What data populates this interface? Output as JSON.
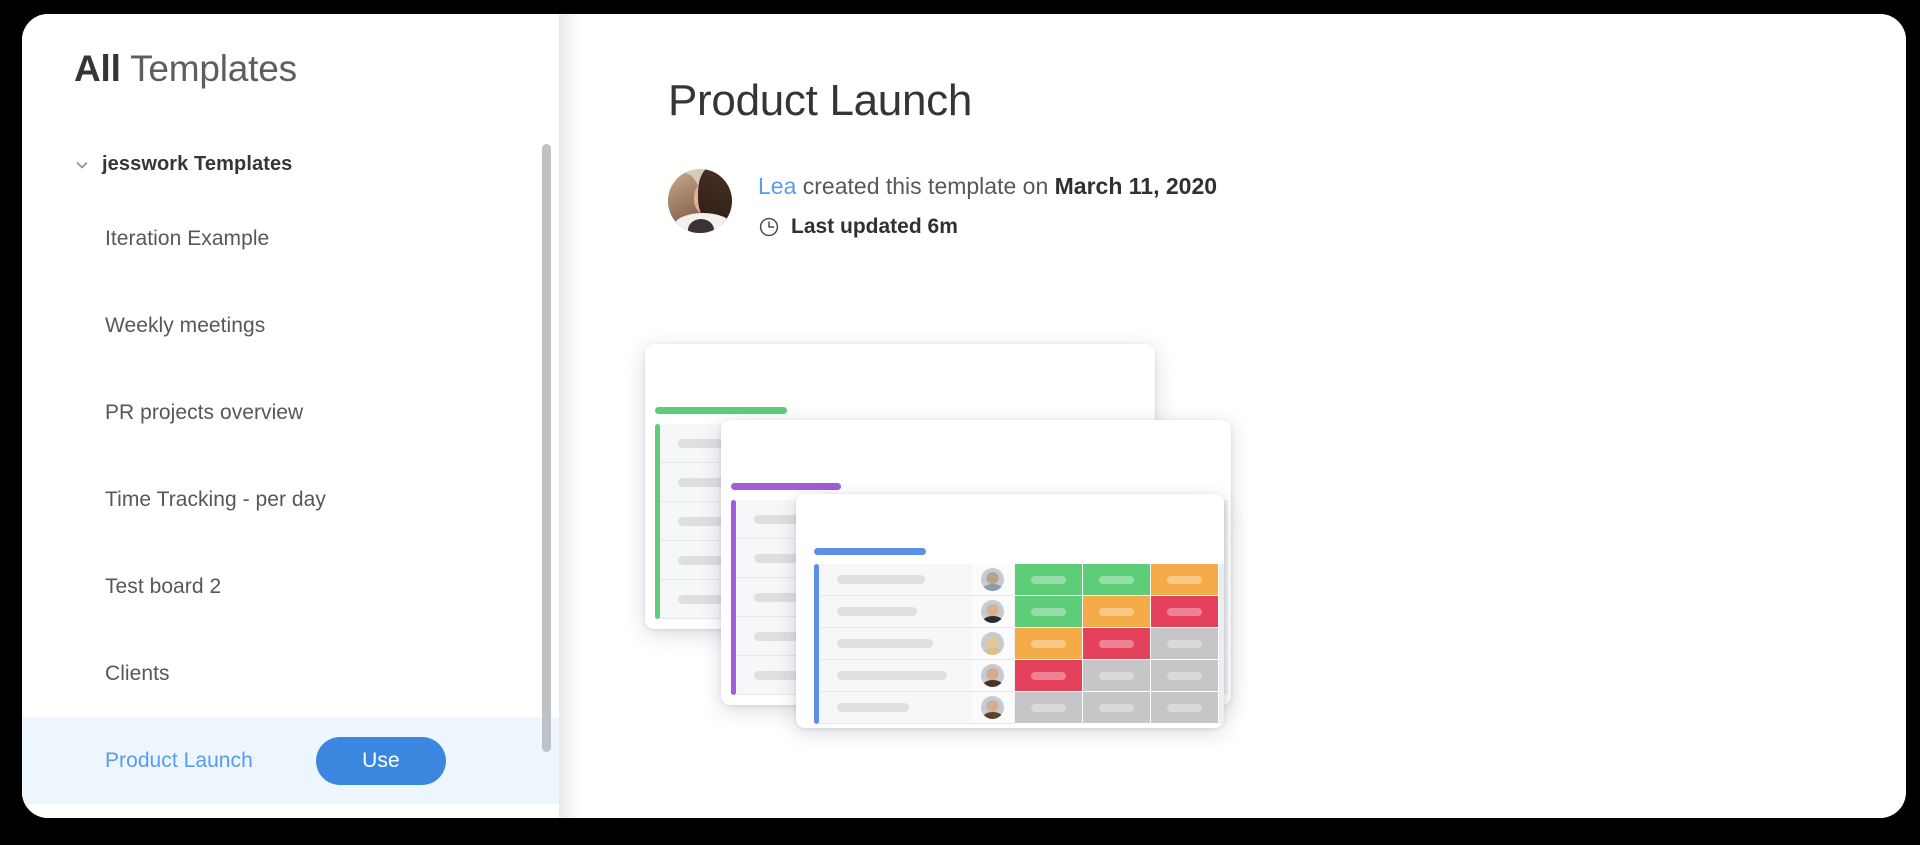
{
  "window": {
    "title": "All Templates"
  },
  "sidebar": {
    "title_strong": "All",
    "title_rest": " Templates",
    "group": {
      "label": "jesswork Templates",
      "expanded": true,
      "chevron_icon": "chevron-down-icon"
    },
    "items": [
      {
        "label": "Iteration Example",
        "selected": false
      },
      {
        "label": "Weekly meetings",
        "selected": false
      },
      {
        "label": "PR projects overview",
        "selected": false
      },
      {
        "label": "Time Tracking - per day",
        "selected": false
      },
      {
        "label": "Test board 2",
        "selected": false
      },
      {
        "label": "Clients",
        "selected": false
      },
      {
        "label": "Product Launch",
        "selected": true,
        "action_label": "Use"
      }
    ],
    "scrollbar": {
      "present": true
    }
  },
  "main": {
    "title": "Product Launch",
    "byline": {
      "author": "Lea",
      "middle": " created this template on ",
      "date": "March 11, 2020",
      "clock_icon": "clock-icon",
      "updated": "Last updated 6m",
      "avatar_icon": "avatar"
    }
  },
  "colors": {
    "accent_blue": "#3b87e0",
    "link_blue": "#5a9bf0",
    "selected_row_bg": "#edf5fd",
    "card_green": "#5ecd7b",
    "card_purple": "#a25ddc",
    "card_blue": "#5c8fe8",
    "status_green": "#5ecd78",
    "status_orange": "#f5ab48",
    "status_red": "#e4415c",
    "status_gray": "#c4c6c8",
    "empty_gray": "#ebedef",
    "scrollbar": "#bfc2c4"
  },
  "preview_cards": [
    {
      "name": "board-card-back",
      "accent_color": "#5ecd7b",
      "rows": [
        {
          "status": [
            "green",
            "green",
            "orange",
            "empty"
          ]
        },
        {
          "status": [
            "green",
            "green",
            "orange",
            "empty"
          ]
        },
        {
          "status": [
            "green",
            "orange",
            "orange",
            "empty"
          ]
        },
        {
          "status": [
            "orange",
            "orange",
            "empty",
            "empty"
          ]
        },
        {
          "status": [
            "orange",
            "empty",
            "empty",
            "empty"
          ]
        }
      ]
    },
    {
      "name": "board-card-middle",
      "accent_color": "#a25ddc",
      "rows": [
        {
          "status": [
            "green",
            "green",
            "orange",
            "empty"
          ]
        },
        {
          "status": [
            "green",
            "orange",
            "red",
            "empty"
          ]
        },
        {
          "status": [
            "orange",
            "red",
            "gray",
            "empty"
          ]
        },
        {
          "status": [
            "red",
            "gray",
            "gray",
            "empty"
          ]
        },
        {
          "status": [
            "gray",
            "gray",
            "gray",
            "empty"
          ]
        }
      ]
    },
    {
      "name": "board-card-front",
      "accent_color": "#5c8fe8",
      "rows": [
        {
          "status": [
            "green",
            "green",
            "orange",
            "empty"
          ]
        },
        {
          "status": [
            "green",
            "orange",
            "red",
            "empty"
          ]
        },
        {
          "status": [
            "orange",
            "red",
            "gray",
            "empty"
          ]
        },
        {
          "status": [
            "red",
            "gray",
            "gray",
            "empty"
          ]
        },
        {
          "status": [
            "gray",
            "gray",
            "gray",
            "empty"
          ]
        }
      ]
    }
  ]
}
